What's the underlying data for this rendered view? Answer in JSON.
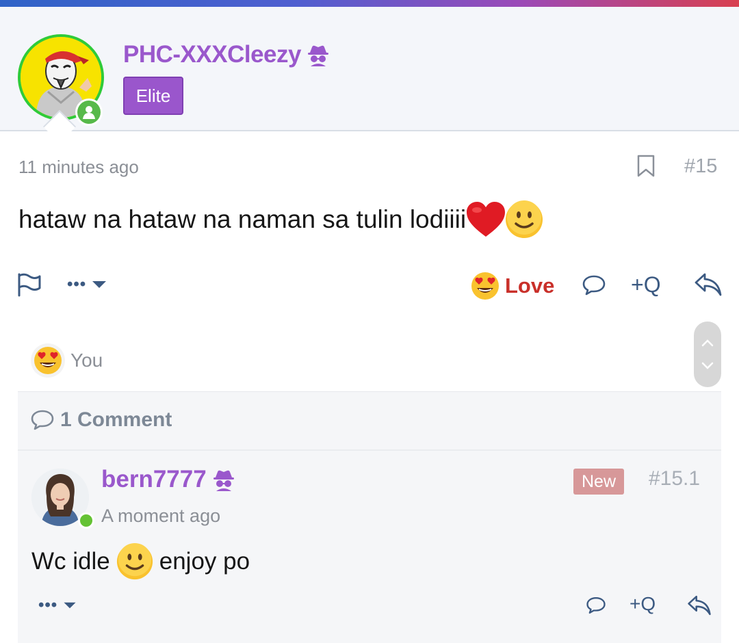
{
  "colors": {
    "username": "#9a58cc",
    "elite_badge": "#9a56cc",
    "love": "#c9302a",
    "action_icon": "#3c5a82",
    "online": "#57b94a",
    "new_badge": "#d79899"
  },
  "post": {
    "author": {
      "username": "PHC-XXXCleezy",
      "badge": "Elite",
      "avatar_icon": "masked-cartoon-avatar",
      "status_icon": "online-user-icon"
    },
    "time": "11 minutes ago",
    "number": "#15",
    "body_text": "hataw na hataw na naman sa tulin lodiiii",
    "body_emojis": [
      "red-heart",
      "slightly-smiling-face"
    ],
    "actions": {
      "report_icon": "flag-icon",
      "more_label": "•••",
      "reaction_label": "Love",
      "reaction_icon": "heart-eyes-emoji",
      "quote_label": "+Q"
    },
    "reactions": {
      "emoji": "heart-eyes-emoji",
      "who": "You"
    }
  },
  "comments": {
    "count_label": "1 Comment",
    "items": [
      {
        "username": "bern7777",
        "time": "A moment ago",
        "badge": "New",
        "number": "#15.1",
        "text_before": "Wc idle",
        "emoji": "slightly-smiling-face",
        "text_after": "enjoy po",
        "more_label": "•••",
        "quote_label": "+Q"
      }
    ]
  }
}
